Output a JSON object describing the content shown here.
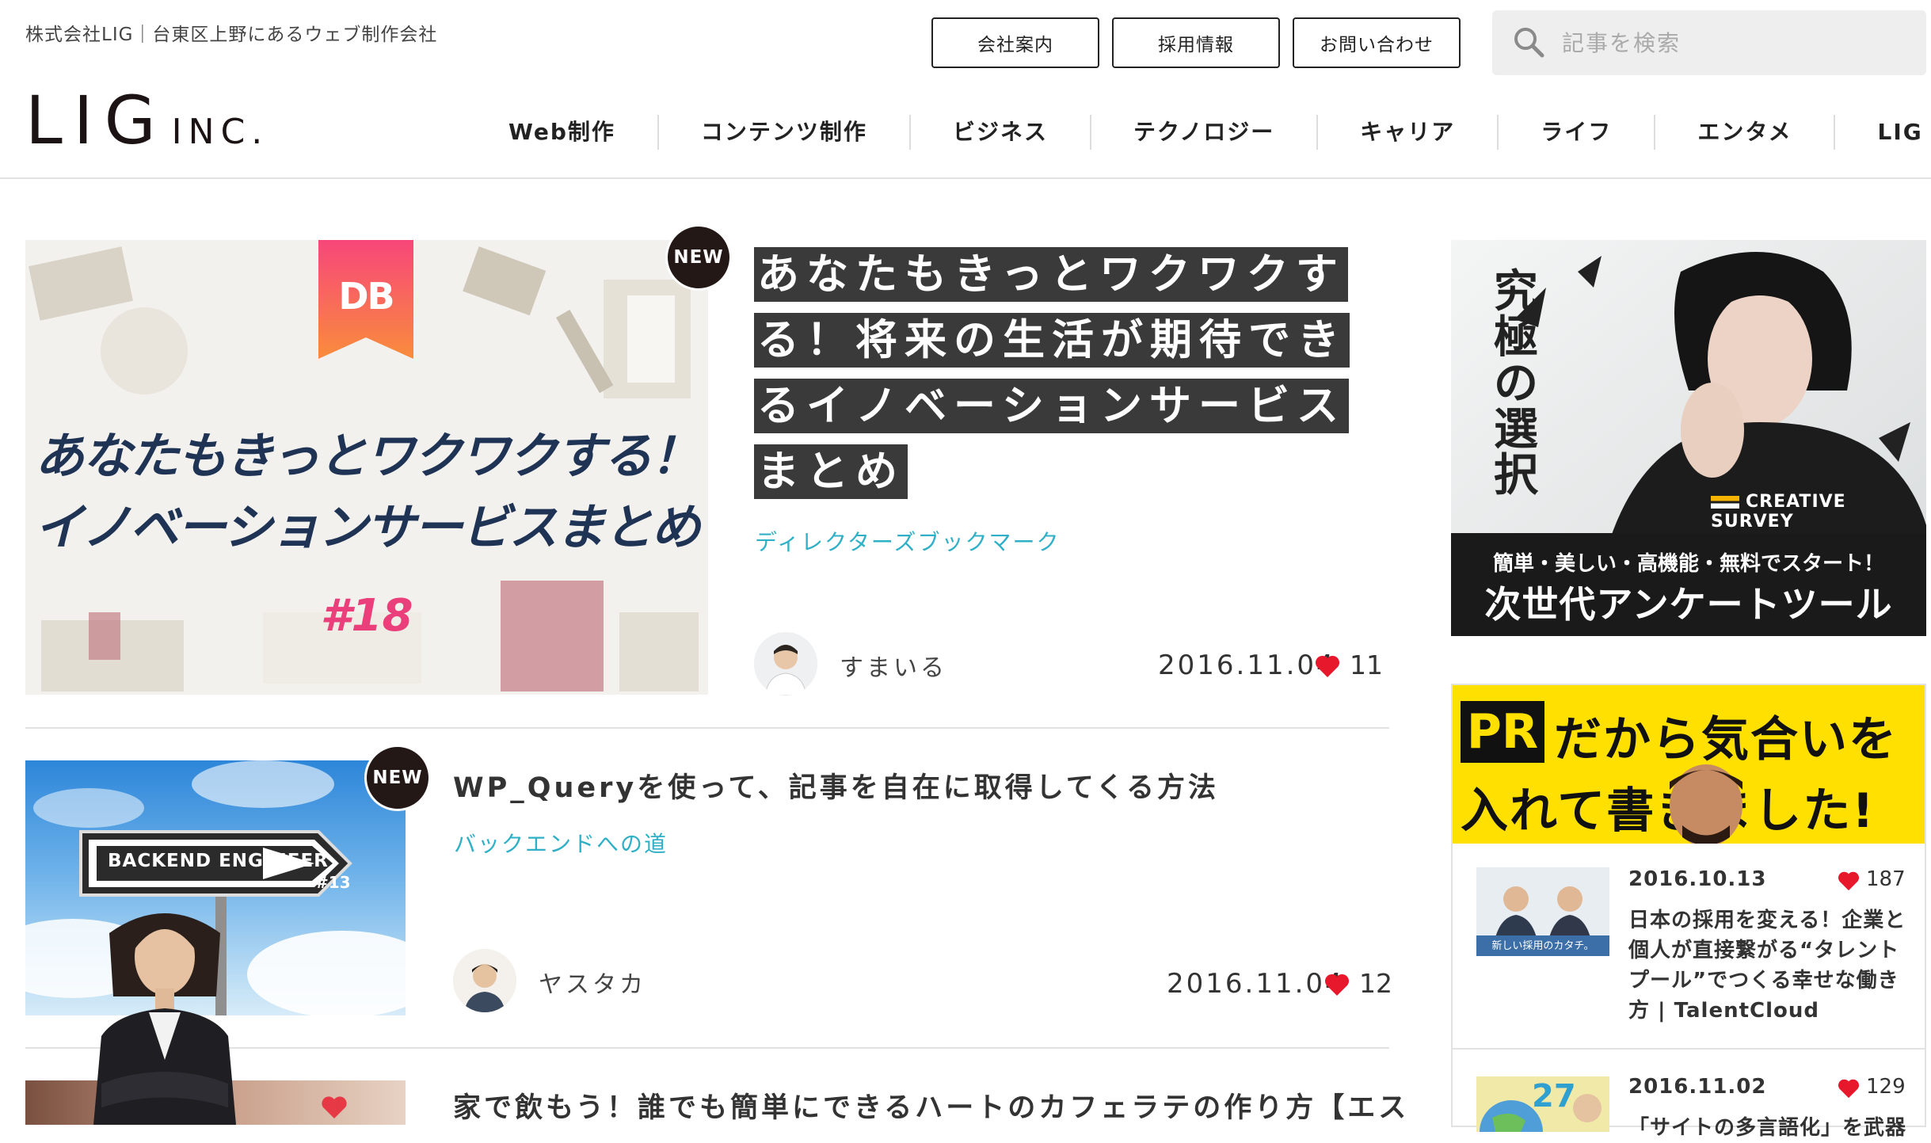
{
  "header": {
    "tagline": "株式会社LIG｜台東区上野にあるウェブ制作会社",
    "logo_main": "LIG",
    "logo_sub": "INC.",
    "buttons": [
      "会社案内",
      "採用情報",
      "お問い合わせ"
    ],
    "search_placeholder": "記事を検索",
    "nav": [
      "Web制作",
      "コンテンツ制作",
      "ビジネス",
      "テクノロジー",
      "キャリア",
      "ライフ",
      "エンタメ",
      "LIG"
    ]
  },
  "articles": [
    {
      "badge": "NEW",
      "thumb_logo": "DB",
      "thumb_line1": "あなたもきっとワクワクする！",
      "thumb_line2": "イノベーションサービスまとめ",
      "thumb_number": "#18",
      "title": "あなたもきっとワクワクする！将来の生活が期待できるイノベーションサービスまとめ",
      "category": "ディレクターズブックマーク",
      "author": "すまいる",
      "date": "2016.11.04",
      "likes": "11"
    },
    {
      "badge": "NEW",
      "thumb_sign": "BACKEND ENGINEER",
      "thumb_sign_num": "#13",
      "title": "WP_Queryを使って、記事を自在に取得してくる方法",
      "category": "バックエンドへの道",
      "author": "ヤスタカ",
      "date": "2016.11.04",
      "likes": "12"
    },
    {
      "title": "家で飲もう！誰でも簡単にできるハートのカフェラテの作り方【エス"
    }
  ],
  "sidebar": {
    "ad1": {
      "vertical_text": "究極の選択",
      "brand": "CREATIVE SURVEY",
      "line1": "簡単・美しい・高機能・無料でスタート！",
      "line2": "次世代アンケートツール"
    },
    "pr": {
      "tag": "PR",
      "headline1": "だから気合いを",
      "headline2": "入れて書きました!",
      "items": [
        {
          "date": "2016.10.13",
          "likes": "187",
          "text": "日本の採用を変える！企業と個人が直接繋がる“タレントプール”でつくる幸せな働き方 | TalentCloud",
          "thumb_caption": "新しい採用のカタチ。"
        },
        {
          "date": "2016.11.02",
          "likes": "129",
          "text": "「サイトの多言語化」を武器",
          "thumb_caption": "27"
        }
      ]
    }
  },
  "colors": {
    "accent_cyan": "#2fb0c6",
    "heart_red": "#e8182c",
    "badge_dark": "#231815",
    "pr_yellow": "#ffe000"
  }
}
